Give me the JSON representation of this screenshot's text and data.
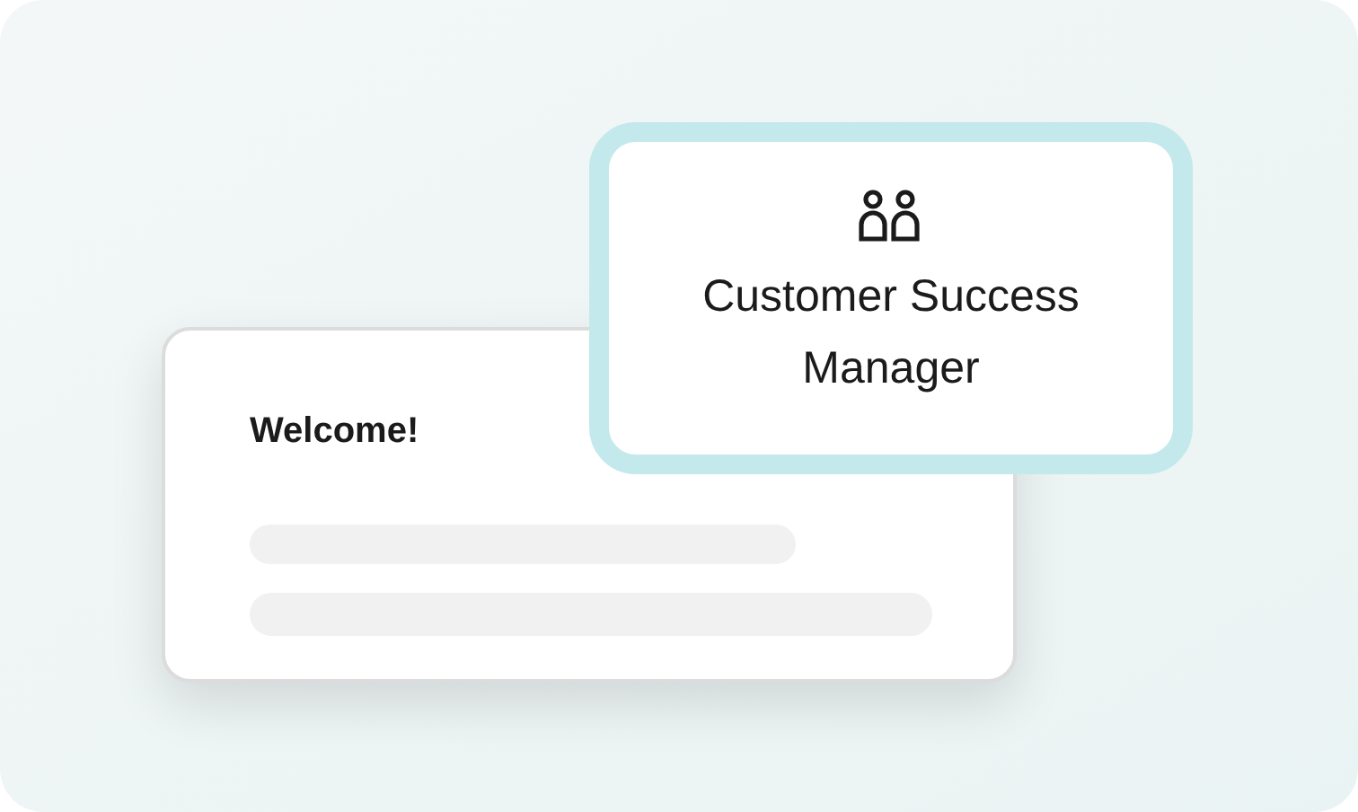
{
  "welcome_card": {
    "title": "Welcome!"
  },
  "role_card": {
    "title": "Customer Success Manager"
  }
}
